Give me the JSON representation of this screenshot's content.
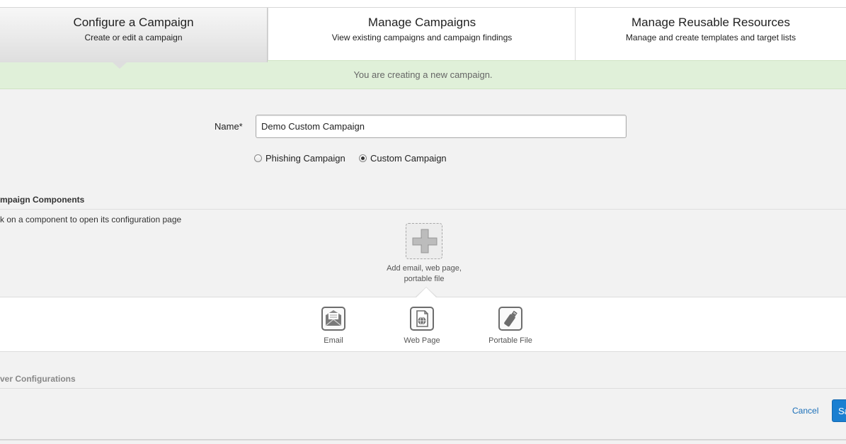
{
  "tabs": [
    {
      "title": "Configure a Campaign",
      "subtitle": "Create or edit a campaign"
    },
    {
      "title": "Manage Campaigns",
      "subtitle": "View existing campaigns and campaign findings"
    },
    {
      "title": "Manage Reusable Resources",
      "subtitle": "Manage and create templates and target lists"
    }
  ],
  "notice": "You are creating a new campaign.",
  "form": {
    "name_label": "Name*",
    "name_value": "Demo Custom Campaign",
    "radio_phishing": "Phishing Campaign",
    "radio_custom": "Custom Campaign",
    "selected_type": "Custom Campaign"
  },
  "components": {
    "heading": "mpaign Components",
    "hint": "k on a component to open its configuration page",
    "add_caption_line1": "Add email, web page,",
    "add_caption_line2": "portable file",
    "items": [
      {
        "label": "Email",
        "icon": "envelope-icon"
      },
      {
        "label": "Web Page",
        "icon": "web-page-icon"
      },
      {
        "label": "Portable File",
        "icon": "usb-drive-icon"
      }
    ]
  },
  "server": {
    "heading": "ver Configurations"
  },
  "footer": {
    "cancel": "Cancel",
    "save": "Sa"
  },
  "colors": {
    "accent": "#1b7fd1",
    "notice_bg": "#e0f0d9",
    "link": "#1a6fb8"
  }
}
